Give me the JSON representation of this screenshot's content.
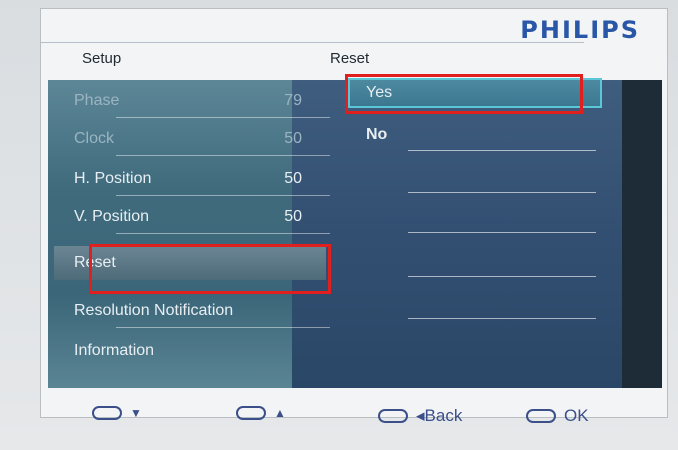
{
  "brand": "PHILIPS",
  "header": {
    "left_title": "Setup",
    "right_title": "Reset"
  },
  "menu": [
    {
      "label": "Phase",
      "value": "79"
    },
    {
      "label": "Clock",
      "value": "50"
    },
    {
      "label": "H. Position",
      "value": "50"
    },
    {
      "label": "V. Position",
      "value": "50"
    },
    {
      "label": "Reset",
      "value": ""
    },
    {
      "label": "Resolution Notification",
      "value": ""
    },
    {
      "label": "Information",
      "value": ""
    }
  ],
  "options": [
    {
      "label": "Yes"
    },
    {
      "label": "No"
    }
  ],
  "footer": {
    "down": "▼",
    "up": "▲",
    "back": "◂Back",
    "ok": "OK"
  },
  "colors": {
    "brand": "#2a56a8",
    "highlight": "#e0201e",
    "footer_text": "#3b4f8a"
  }
}
